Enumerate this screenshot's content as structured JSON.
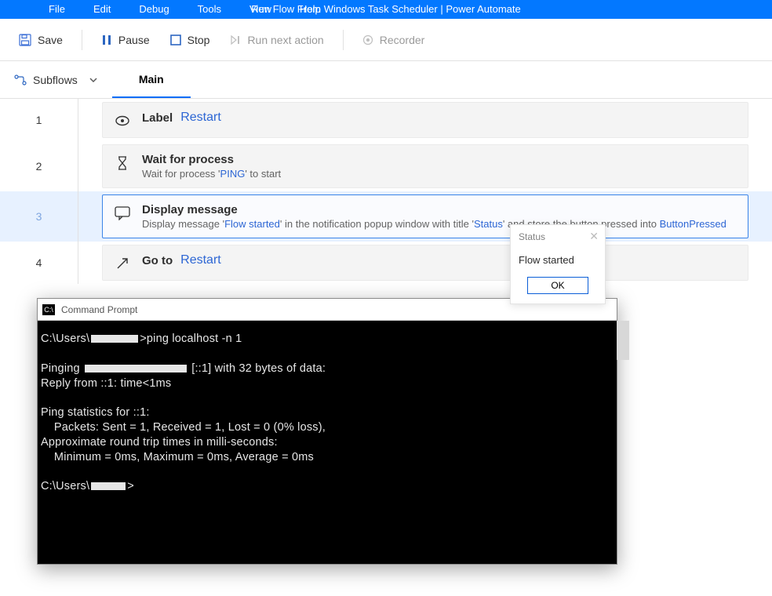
{
  "menubar": {
    "items": [
      "File",
      "Edit",
      "Debug",
      "Tools",
      "View",
      "Help"
    ]
  },
  "app_title": "Run Flow From Windows Task Scheduler | Power Automate",
  "toolbar": {
    "save": "Save",
    "pause": "Pause",
    "stop": "Stop",
    "run_next": "Run next action",
    "recorder": "Recorder"
  },
  "subtabs": {
    "subflows": "Subflows",
    "tabs": [
      {
        "label": "Main",
        "active": true
      }
    ]
  },
  "steps": [
    {
      "num": "1",
      "icon": "label",
      "title": "Label",
      "title_link": "Restart",
      "sub": "",
      "selected": false
    },
    {
      "num": "2",
      "icon": "hourglass",
      "title": "Wait for process",
      "sub_parts": [
        "Wait for process '",
        {
          "p": "PING"
        },
        "' to start"
      ],
      "selected": false
    },
    {
      "num": "3",
      "icon": "message",
      "title": "Display message",
      "sub_parts": [
        "Display message '",
        {
          "p": "Flow started"
        },
        "' in the notification popup window with title '",
        {
          "p": "Status"
        },
        "' and store the button pressed into   "
      ],
      "trailing_link": "ButtonPressed",
      "selected": true
    },
    {
      "num": "4",
      "icon": "goto",
      "title": "Go to",
      "title_link": "Restart",
      "sub": "",
      "selected": false
    }
  ],
  "popup": {
    "title": "Status",
    "body": "Flow started",
    "ok": "OK"
  },
  "cmd": {
    "title": "Command Prompt",
    "prompt_path": "C:\\Users\\",
    "line1_cmd": ">ping localhost -n 1",
    "line2a": "Pinging ",
    "line2b": " [::1] with 32 bytes of data:",
    "line3": "Reply from ::1: time<1ms",
    "line4": "",
    "line5": "Ping statistics for ::1:",
    "line6": "    Packets: Sent = 1, Received = 1, Lost = 0 (0% loss),",
    "line7": "Approximate round trip times in milli-seconds:",
    "line8": "    Minimum = 0ms, Maximum = 0ms, Average = 0ms",
    "line_last": ">"
  }
}
